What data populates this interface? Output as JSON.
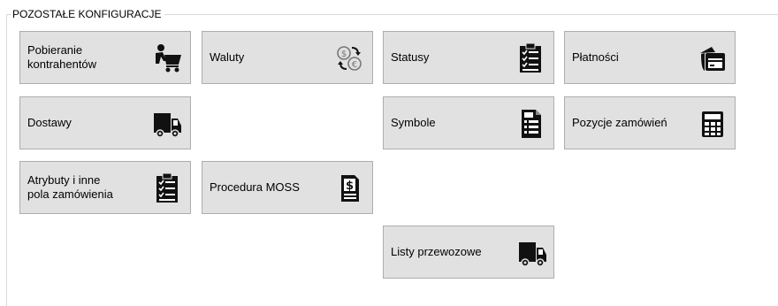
{
  "group": {
    "title": "POZOSTAŁE KONFIGURACJE"
  },
  "buttons": {
    "pobieranie": {
      "label": "Pobieranie\nkontrahentów",
      "icon": "customer-cart-icon"
    },
    "waluty": {
      "label": "Waluty",
      "icon": "currency-exchange-icon"
    },
    "statusy": {
      "label": "Statusy",
      "icon": "clipboard-checklist-icon"
    },
    "platnosci": {
      "label": "Płatności",
      "icon": "wallet-card-icon"
    },
    "dostawy": {
      "label": "Dostawy",
      "icon": "delivery-truck-icon"
    },
    "symbole": {
      "label": "Symbole",
      "icon": "document-list-icon"
    },
    "pozycje": {
      "label": "Pozycje zamówień",
      "icon": "calculator-icon"
    },
    "atrybuty": {
      "label": "Atrybuty i inne\npola zamówienia",
      "icon": "clipboard-checklist-icon"
    },
    "procedura": {
      "label": "Procedura MOSS",
      "icon": "dollar-document-icon"
    },
    "listy": {
      "label": "Listy przewozowe",
      "icon": "delivery-truck-icon"
    }
  }
}
